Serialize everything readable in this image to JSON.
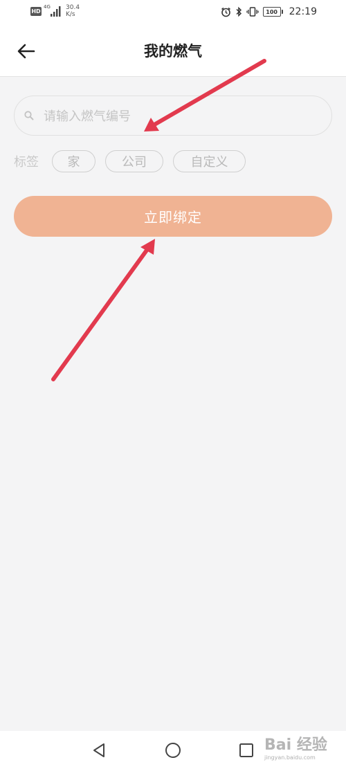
{
  "status_bar": {
    "hd": "HD",
    "network": "4G",
    "speed_value": "30.4",
    "speed_unit": "K/s",
    "battery": "100",
    "time": "22:19"
  },
  "nav": {
    "title": "我的燃气"
  },
  "search": {
    "placeholder": "请输入燃气编号",
    "value": ""
  },
  "tags": {
    "label": "标签",
    "options": [
      "家",
      "公司",
      "自定义"
    ]
  },
  "bind_button": {
    "label": "立即绑定"
  },
  "watermark": {
    "text": "Bai 经验",
    "sub": "jingyan.baidu.com"
  },
  "colors": {
    "accent": "#f0b393",
    "annotation_arrow": "#e23a4e",
    "background": "#f4f4f5"
  }
}
